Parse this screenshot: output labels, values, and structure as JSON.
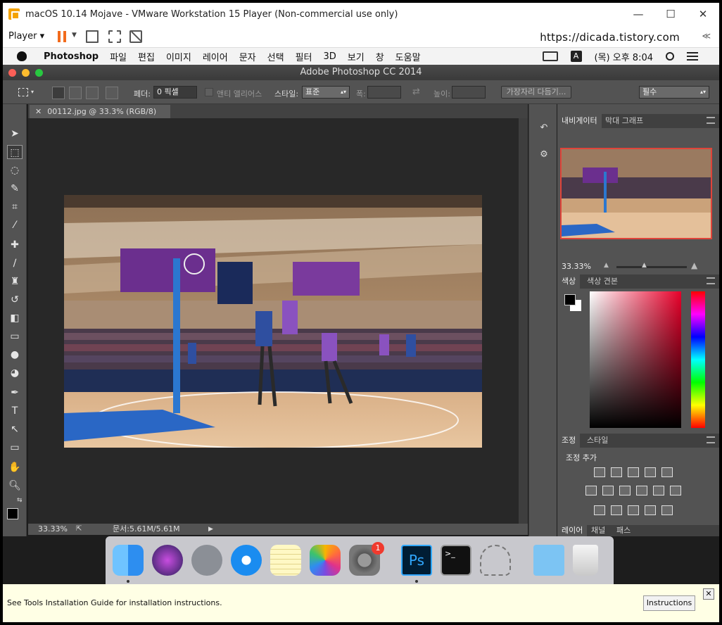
{
  "vmware": {
    "title": "macOS 10.14 Mojave - VMware Workstation 15 Player (Non-commercial use only)",
    "player_label": "Player",
    "url": "https://dicada.tistory.com",
    "more_label": "≪",
    "window_buttons": [
      "—",
      "☐",
      "✕"
    ]
  },
  "menubar": {
    "app_name": "Photoshop",
    "items": [
      "파일",
      "편집",
      "이미지",
      "레이어",
      "문자",
      "선택",
      "필터",
      "3D",
      "보기",
      "창",
      "도움말"
    ],
    "input_badge": "A",
    "clock": "(목) 오후 8:04"
  },
  "photoshop": {
    "window_title": "Adobe Photoshop CC 2014",
    "options": {
      "feather_label": "페더:",
      "feather_value": "0 픽셀",
      "antialias_label": "앤티 앨리어스",
      "style_label": "스타일:",
      "style_value": "표준",
      "width_label": "폭:",
      "height_label": "높이:",
      "refine_edge_label": "가장자리 다듬기...",
      "workspace_value": "필수"
    },
    "document": {
      "tab_label": "00112.jpg @ 33.3% (RGB/8)",
      "zoom": "33.33%",
      "doc_size": "문서:5.61M/5.61M"
    },
    "panels": {
      "navigator_tabs": [
        "내비게이터",
        "막대 그래프"
      ],
      "navigator_zoom": "33.33%",
      "color_tabs": [
        "색상",
        "색상 견본"
      ],
      "adjust_tabs": [
        "조정",
        "스타일"
      ],
      "adjust_add_label": "조정 추가",
      "layer_tabs": [
        "레이어",
        "채널",
        "패스"
      ]
    }
  },
  "dock": {
    "apps": [
      "Finder",
      "Siri",
      "Launchpad",
      "Safari",
      "Notes",
      "Photos",
      "System Preferences",
      "Photoshop",
      "Terminal",
      "Automator",
      "Downloads",
      "Trash"
    ],
    "badge_count": "1"
  },
  "infobar": {
    "message": "See Tools Installation Guide for installation instructions.",
    "button_label": "Instructions"
  },
  "colors": {
    "ps_panel": "#535353",
    "ps_canvas": "#282828",
    "vm_pause": "#f26b1d",
    "nav_highlight": "#e0443a"
  }
}
